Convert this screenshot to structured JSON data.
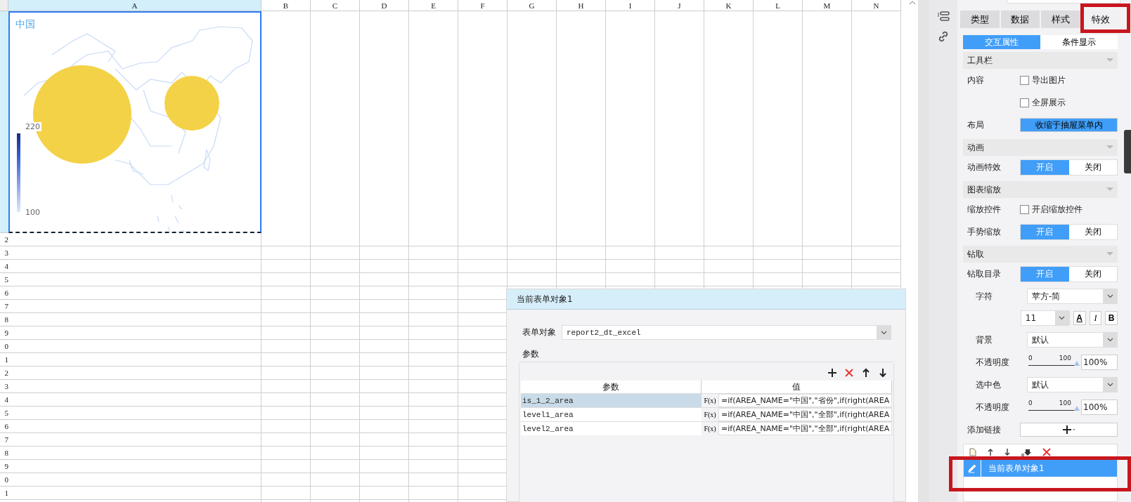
{
  "sheet": {
    "columns": [
      {
        "label": "A",
        "selected": true
      },
      {
        "label": "B",
        "selected": false
      },
      {
        "label": "C",
        "selected": false
      },
      {
        "label": "D",
        "selected": false
      },
      {
        "label": "E",
        "selected": false
      },
      {
        "label": "F",
        "selected": false
      },
      {
        "label": "G",
        "selected": false
      },
      {
        "label": "H",
        "selected": false
      },
      {
        "label": "I",
        "selected": false
      },
      {
        "label": "J",
        "selected": false
      },
      {
        "label": "K",
        "selected": false
      },
      {
        "label": "L",
        "selected": false
      },
      {
        "label": "M",
        "selected": false
      },
      {
        "label": "N",
        "selected": false
      }
    ],
    "rows": [
      "2",
      "3",
      "4",
      "5",
      "6",
      "7",
      "8",
      "9",
      "0",
      "1",
      "2",
      "3",
      "4",
      "5",
      "6",
      "7",
      "8",
      "9",
      "0",
      "1"
    ]
  },
  "chart": {
    "title": "中国",
    "legend": {
      "max": "220",
      "min": "100"
    }
  },
  "dialog": {
    "title": "当前表单对象1",
    "form_object": {
      "label": "表单对象",
      "value": "report2_dt_excel"
    },
    "params": {
      "legend": "参数",
      "columns": [
        "参数",
        "值"
      ],
      "rows": [
        {
          "name": "is_1_2_area",
          "fx": "F(x)",
          "value": "=if(AREA_NAME=\"中国\",\"省份\",if(right(AREA",
          "selected": true
        },
        {
          "name": "level1_area",
          "fx": "F(x)",
          "value": "=if(AREA_NAME=\"中国\",\"全部\",if(right(AREA",
          "selected": false
        },
        {
          "name": "level2_area",
          "fx": "F(x)",
          "value": "=if(AREA_NAME=\"中国\",\"全部\",if(right(AREA",
          "selected": false
        }
      ]
    }
  },
  "panel": {
    "tabs": [
      {
        "label": "类型",
        "selected": false,
        "highlighted": false
      },
      {
        "label": "数据",
        "selected": false,
        "highlighted": false
      },
      {
        "label": "样式",
        "selected": false,
        "highlighted": false
      },
      {
        "label": "特效",
        "selected": true,
        "highlighted": true
      }
    ],
    "subtabs": [
      {
        "label": "交互属性",
        "selected": true
      },
      {
        "label": "条件显示",
        "selected": false
      }
    ],
    "sections": [
      {
        "title": "工具栏",
        "rows": [
          {
            "kind": "checkbox",
            "label": "内容",
            "option": "导出图片",
            "checked": false
          },
          {
            "kind": "checkbox",
            "option": "全屏展示",
            "checked": false
          },
          {
            "kind": "button",
            "label": "布局",
            "button": "收缩于抽屉菜单内"
          }
        ]
      },
      {
        "title": "动画",
        "rows": [
          {
            "kind": "toggle",
            "label": "动画特效",
            "options": [
              {
                "label": "开启",
                "selected": true
              },
              {
                "label": "关闭",
                "selected": false
              }
            ]
          }
        ]
      },
      {
        "title": "图表缩放",
        "rows": [
          {
            "kind": "checkbox",
            "label": "缩放控件",
            "option": "开启缩放控件",
            "checked": false
          },
          {
            "kind": "toggle",
            "label": "手势缩放",
            "options": [
              {
                "label": "开启",
                "selected": true
              },
              {
                "label": "关闭",
                "selected": false
              }
            ]
          }
        ]
      },
      {
        "title": "钻取",
        "rows": [
          {
            "kind": "toggle",
            "label": "钻取目录",
            "options": [
              {
                "label": "开启",
                "selected": true
              },
              {
                "label": "关闭",
                "selected": false
              }
            ]
          },
          {
            "kind": "select",
            "label": "字符",
            "value": "苹方-简"
          },
          {
            "kind": "font",
            "size": "11",
            "styles": [
              "A",
              "I",
              "B"
            ]
          },
          {
            "kind": "select",
            "label": "背景",
            "value": "默认"
          },
          {
            "kind": "slider",
            "label": "不透明度",
            "min": "0",
            "max": "100",
            "level": 1,
            "value": "100%"
          },
          {
            "kind": "select",
            "label": "选中色",
            "value": "默认"
          },
          {
            "kind": "slider",
            "label": "不透明度",
            "min": "0",
            "max": "100",
            "level": 1,
            "value": "100%"
          },
          {
            "kind": "add_link",
            "label": "添加链接"
          },
          {
            "kind": "link_list",
            "items": [
              {
                "label": "当前表单对象1",
                "selected": true,
                "highlighted": true
              }
            ]
          }
        ]
      }
    ]
  }
}
